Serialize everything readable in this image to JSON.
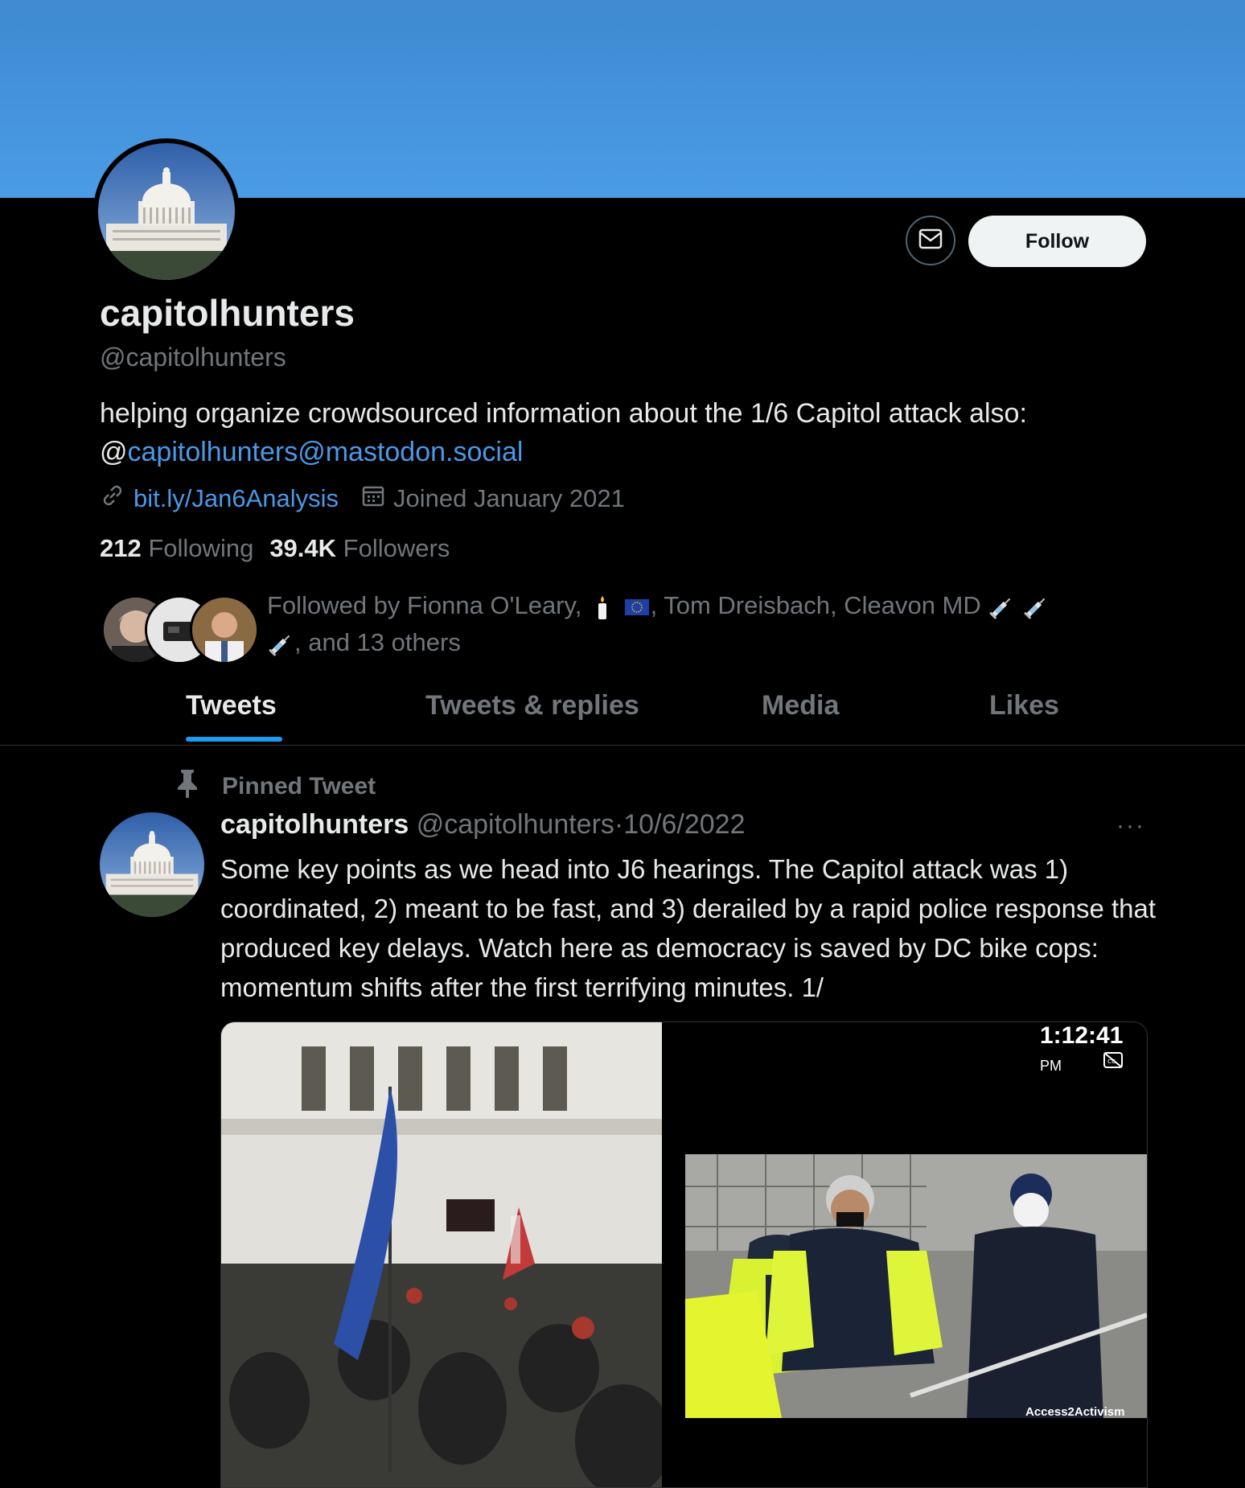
{
  "profile": {
    "display_name": "capitolhunters",
    "handle": "@capitolhunters",
    "bio_text": "helping organize crowdsourced information about the 1/6 Capitol attack also: ",
    "bio_at": "@",
    "bio_link": "capitolhunters@mastodon.social",
    "website": "bit.ly/Jan6Analysis",
    "joined": "Joined January 2021",
    "following_count": "212",
    "following_label": "Following",
    "followers_count": "39.4K",
    "followers_label": "Followers"
  },
  "buttons": {
    "follow": "Follow"
  },
  "followed_by": {
    "line1": "Followed by Fionna O'Leary, ",
    "line1b": ", Tom Dreisbach, Cleavon MD",
    "line2": ", and 13 others"
  },
  "tabs": [
    {
      "label": "Tweets",
      "active": true
    },
    {
      "label": "Tweets & replies",
      "active": false
    },
    {
      "label": "Media",
      "active": false
    },
    {
      "label": "Likes",
      "active": false
    }
  ],
  "tweet": {
    "pinned_label": "Pinned Tweet",
    "author_name": "capitolhunters",
    "author_handle": "@capitolhunters",
    "separator": "·",
    "date": "10/6/2022",
    "more": "···",
    "text": "Some key points as we head into J6 hearings. The Capitol attack was 1) coordinated, 2) meant to be fast, and 3) derailed by a rapid police response that produced key delays. Watch here as democracy is saved by DC bike cops: momentum shifts after the first terrifying minutes. 1/",
    "media": {
      "timestamp": "1:12:41",
      "timestamp_suffix": "PM",
      "watermark": "Access2Activism"
    }
  },
  "colors": {
    "banner": "#4a9be6",
    "link": "#4a99e9",
    "accent": "#1d9bf0",
    "secondary_text": "#71767b"
  },
  "icons": [
    "envelope-icon",
    "link-icon",
    "calendar-icon",
    "pin-icon",
    "syringe-icon",
    "candle-icon",
    "eu-flag-icon",
    "closed-caption-icon"
  ]
}
